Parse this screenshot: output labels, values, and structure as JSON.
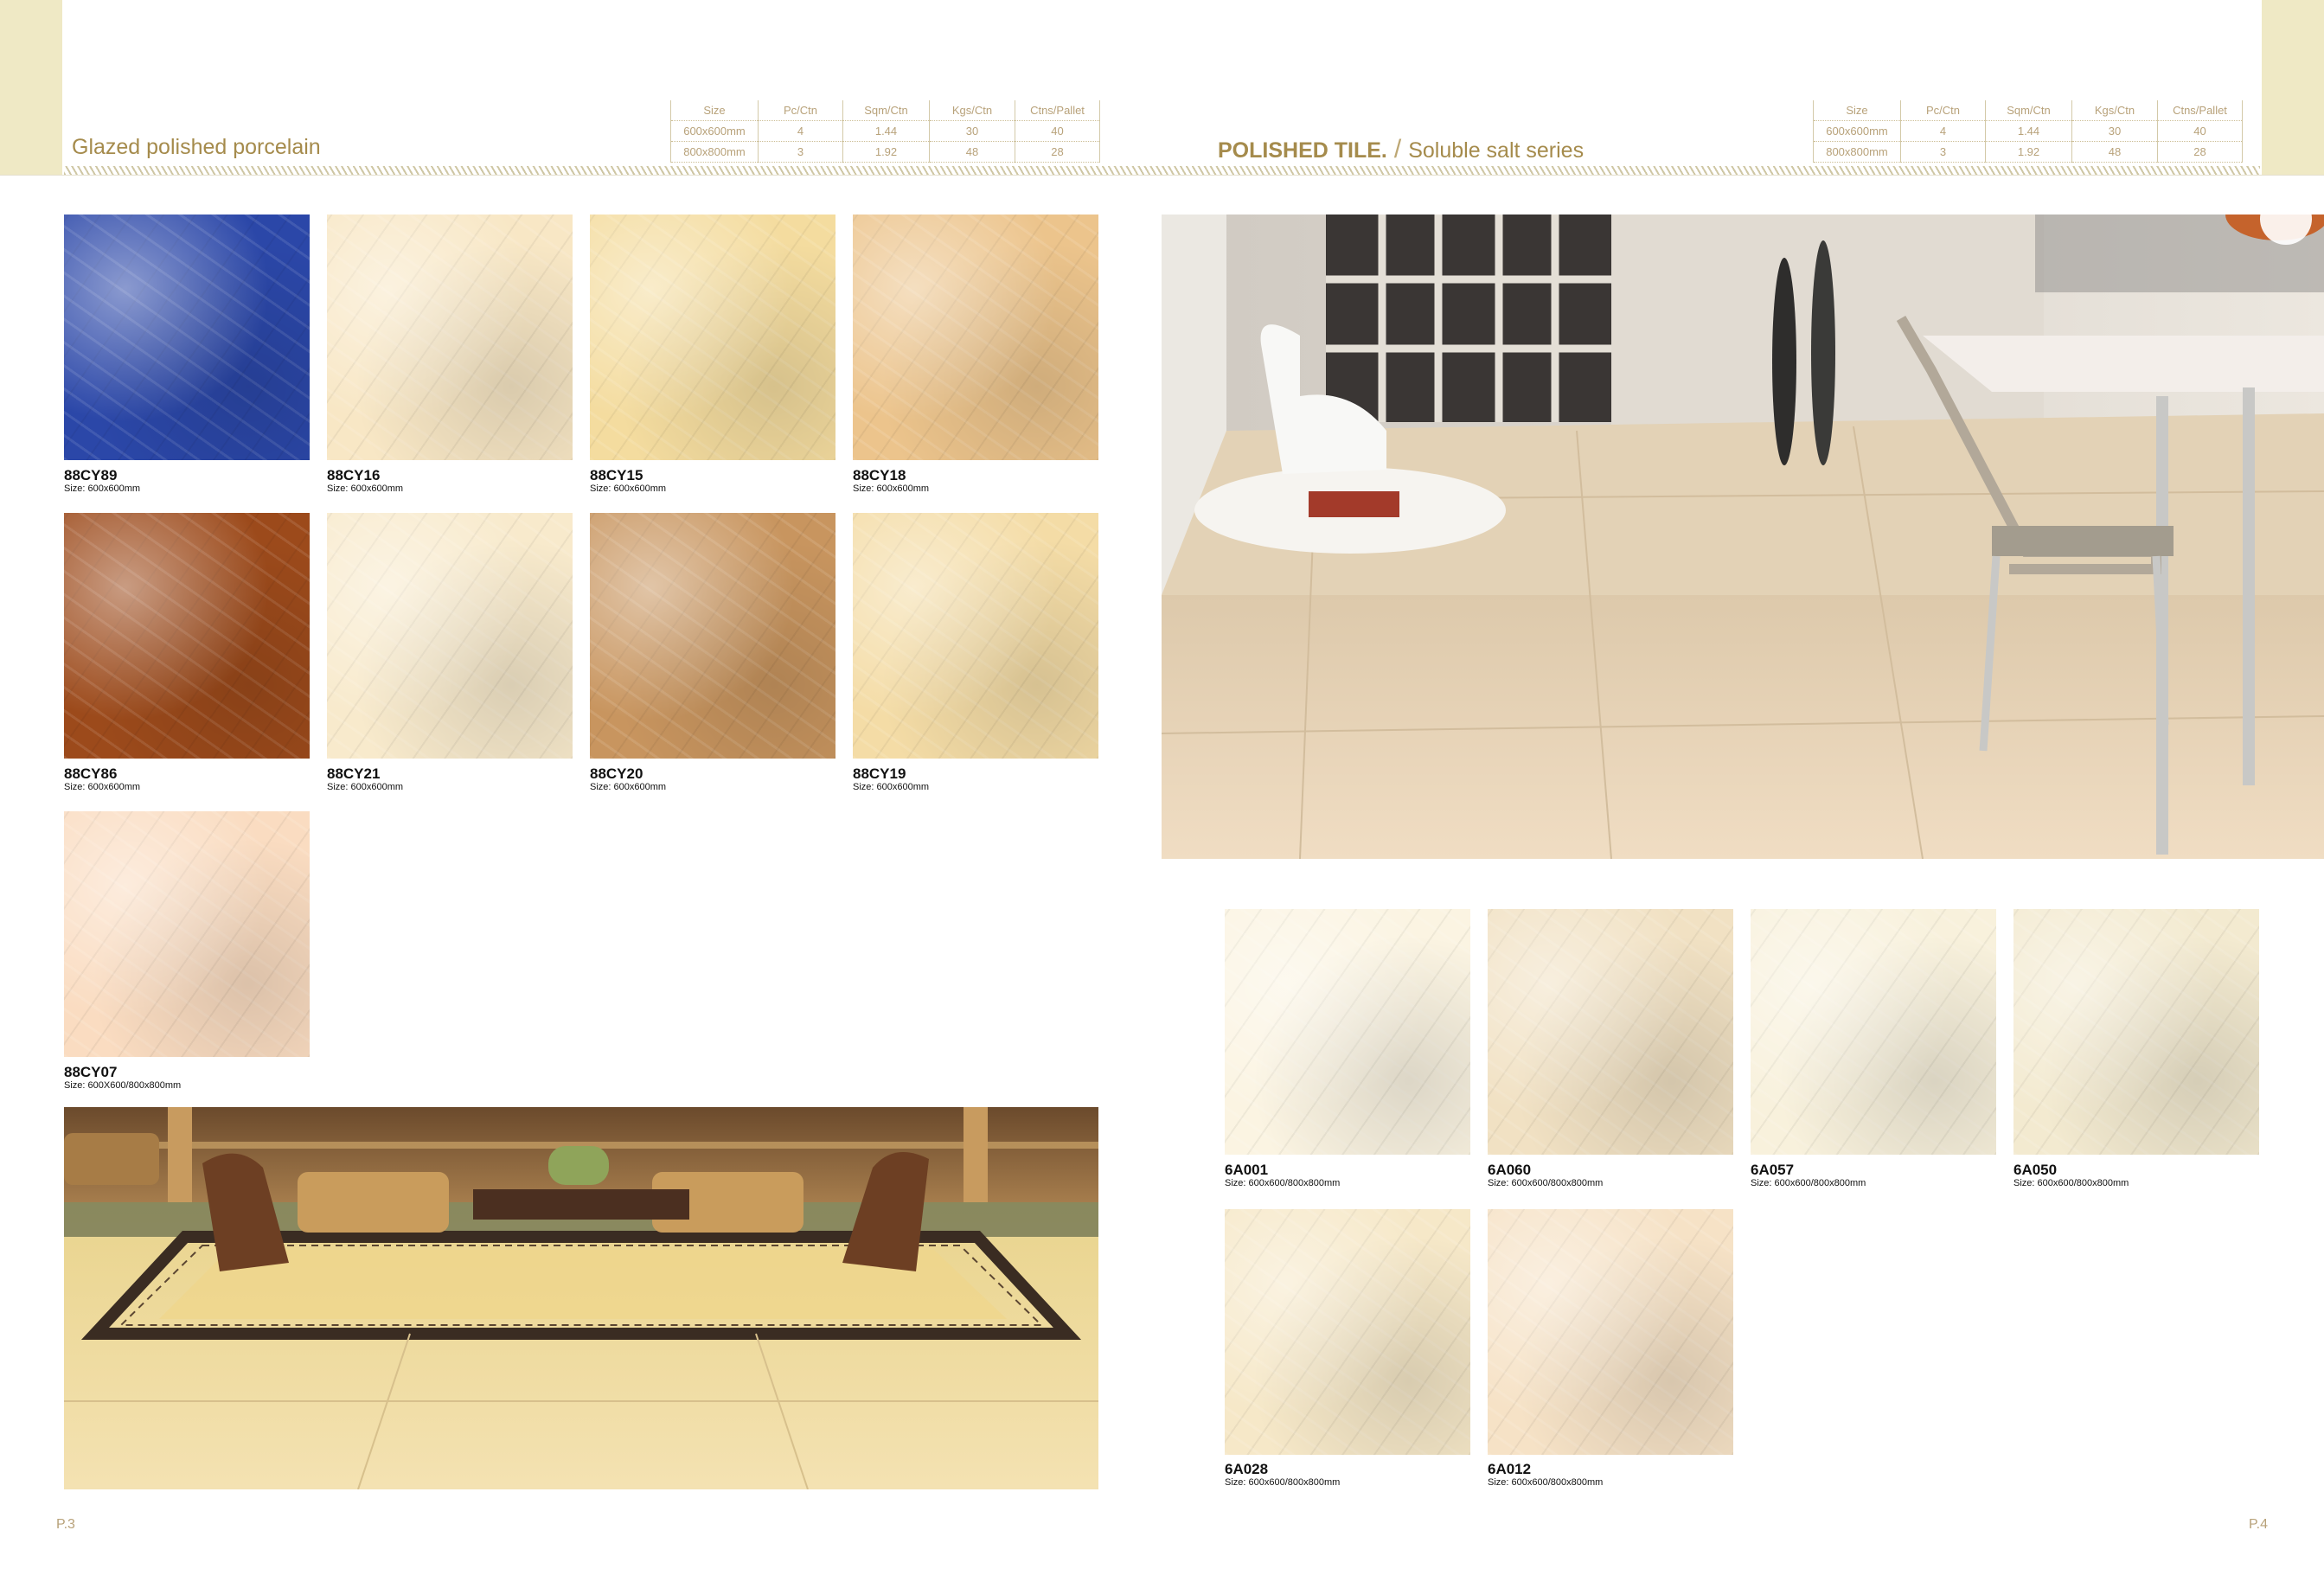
{
  "left_page": {
    "header_title": "Glazed polished porcelain",
    "spec_table": {
      "headers": [
        "Size",
        "Pc/Ctn",
        "Sqm/Ctn",
        "Kgs/Ctn",
        "Ctns/Pallet"
      ],
      "rows": [
        [
          "600x600mm",
          "4",
          "1.44",
          "30",
          "40"
        ],
        [
          "800x800mm",
          "3",
          "1.92",
          "48",
          "28"
        ]
      ]
    },
    "tiles": [
      {
        "code": "88CY89",
        "size": "Size: 600x600mm",
        "color": "#2b47a8"
      },
      {
        "code": "88CY16",
        "size": "Size: 600x600mm",
        "color": "#f8e7c5"
      },
      {
        "code": "88CY15",
        "size": "Size: 600x600mm",
        "color": "#f4dc9f"
      },
      {
        "code": "88CY18",
        "size": "Size: 600x600mm",
        "color": "#ecc48c"
      },
      {
        "code": "88CY86",
        "size": "Size: 600x600mm",
        "color": "#9c4a1b"
      },
      {
        "code": "88CY21",
        "size": "Size: 600x600mm",
        "color": "#f8eacc"
      },
      {
        "code": "88CY20",
        "size": "Size: 600x600mm",
        "color": "#c8955f"
      },
      {
        "code": "88CY19",
        "size": "Size: 600x600mm",
        "color": "#f4dca6"
      },
      {
        "code": "88CY07",
        "size": "Size: 600X600/800x800mm",
        "color": "#fadcc1"
      }
    ],
    "page_number": "P.3"
  },
  "right_page": {
    "header_title_bold": "POLISHED TILE.",
    "header_separator": "/",
    "header_title_rest": "Soluble salt series",
    "spec_table": {
      "headers": [
        "Size",
        "Pc/Ctn",
        "Sqm/Ctn",
        "Kgs/Ctn",
        "Ctns/Pallet"
      ],
      "rows": [
        [
          "600x600mm",
          "4",
          "1.44",
          "30",
          "40"
        ],
        [
          "800x800mm",
          "3",
          "1.92",
          "48",
          "28"
        ]
      ]
    },
    "tiles": [
      {
        "code": "6A001",
        "size": "Size: 600x600/800x800mm",
        "color": "#fbf4e2"
      },
      {
        "code": "6A060",
        "size": "Size: 600x600/800x800mm",
        "color": "#f1e1c3"
      },
      {
        "code": "6A057",
        "size": "Size: 600x600/800x800mm",
        "color": "#f8f1dc"
      },
      {
        "code": "6A050",
        "size": "Size: 600x600/800x800mm",
        "color": "#f3ead0"
      },
      {
        "code": "6A028",
        "size": "Size: 600x600/800x800mm",
        "color": "#f6e8c8"
      },
      {
        "code": "6A012",
        "size": "Size: 600x600/800x800mm",
        "color": "#f6e2c6"
      }
    ],
    "page_number": "P.4"
  },
  "icons": {
    "living-room-photo": "lobby-interior-image",
    "dining-room-photo": "dining-interior-image"
  }
}
